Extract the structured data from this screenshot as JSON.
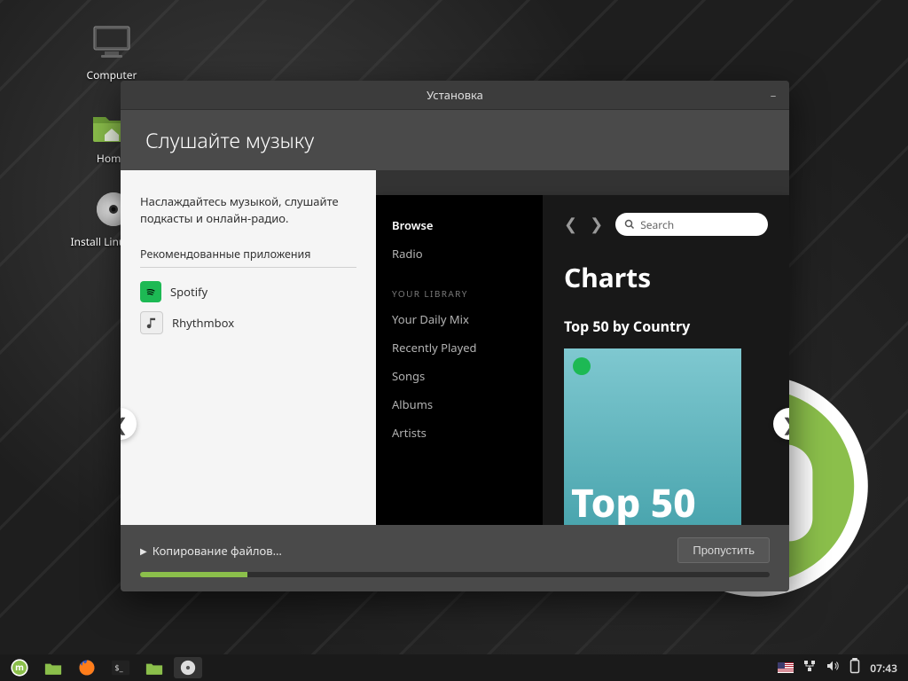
{
  "desktop": {
    "icons": [
      {
        "label": "Computer"
      },
      {
        "label": "Home"
      },
      {
        "label": "Install Linux Mint"
      }
    ]
  },
  "window": {
    "title": "Установка",
    "headline": "Слушайте музыку",
    "intro": "Наслаждайтесь музыкой, слушайте подкасты и онлайн-радио.",
    "apps_title": "Рекомендованные приложения",
    "apps": [
      {
        "name": "Spotify"
      },
      {
        "name": "Rhythmbox"
      }
    ],
    "status": "Копирование файлов…",
    "skip_label": "Пропустить",
    "progress_pct": 17
  },
  "shot": {
    "side": {
      "browse": "Browse",
      "radio": "Radio",
      "library_hdr": "YOUR LIBRARY",
      "items": [
        "Your Daily Mix",
        "Recently Played",
        "Songs",
        "Albums",
        "Artists"
      ]
    },
    "search_placeholder": "Search",
    "charts_title": "Charts",
    "sub_title": "Top 50 by Country",
    "cover_text": "Top 50"
  },
  "taskbar": {
    "clock": "07:43"
  }
}
